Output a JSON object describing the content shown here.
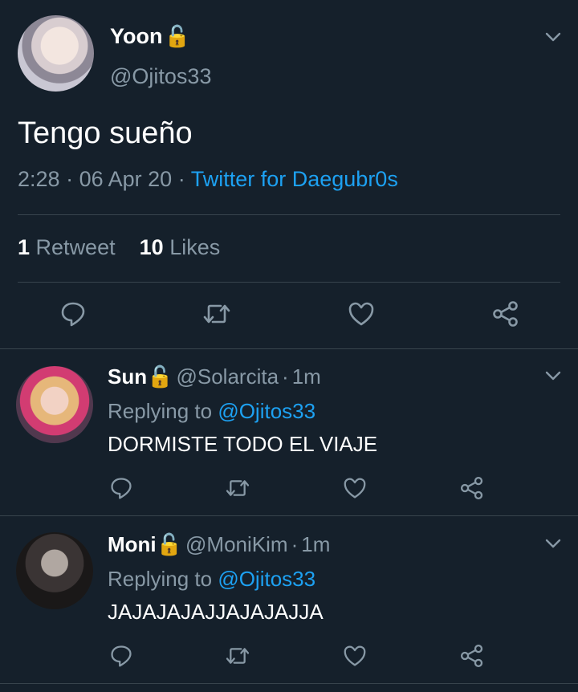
{
  "main_tweet": {
    "author_name": "Yoon",
    "lock_icon": "🔓",
    "handle": "@Ojitos33",
    "text": "Tengo sueño",
    "time": "2:28",
    "date": "06 Apr 20",
    "source": "Twitter for Daegubr0s",
    "retweet_count": "1",
    "retweet_label": "Retweet",
    "like_count": "10",
    "like_label": "Likes"
  },
  "replies": [
    {
      "name": "Sun",
      "lock_icon": "🔓",
      "handle": "@Solarcita",
      "time": "1m",
      "replying_prefix": "Replying to",
      "replying_to": "@Ojitos33",
      "text": "DORMISTE TODO EL VIAJE"
    },
    {
      "name": "Moni",
      "lock_icon": "🔓",
      "handle": "@MoniKim",
      "time": "1m",
      "replying_prefix": "Replying to",
      "replying_to": "@Ojitos33",
      "text": "JAJAJAJAJJAJAJAJJA"
    }
  ],
  "separator": "·",
  "icons": {
    "reply": "reply-icon",
    "retweet": "retweet-icon",
    "like": "heart-icon",
    "share": "share-icon",
    "menu": "chevron-down-icon"
  },
  "colors": {
    "background": "#15202b",
    "accent": "#1da1f2",
    "muted": "#8899a6",
    "divider": "#38444d"
  }
}
